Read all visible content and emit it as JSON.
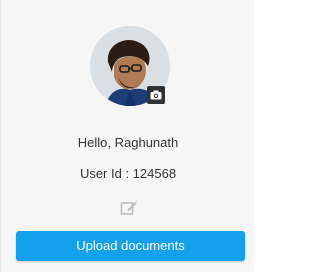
{
  "profile": {
    "avatar_alt": "profile photo",
    "camera_icon": "camera-icon",
    "greeting": "Hello, Raghunath",
    "user_id": "User Id : 124568",
    "edit_icon": "edit-icon"
  },
  "actions": {
    "upload_label": "Upload documents"
  },
  "colors": {
    "accent": "#13a1ec",
    "card_background": "#f6f6f6",
    "text": "#333333",
    "icon_muted": "#bdbdbd"
  }
}
